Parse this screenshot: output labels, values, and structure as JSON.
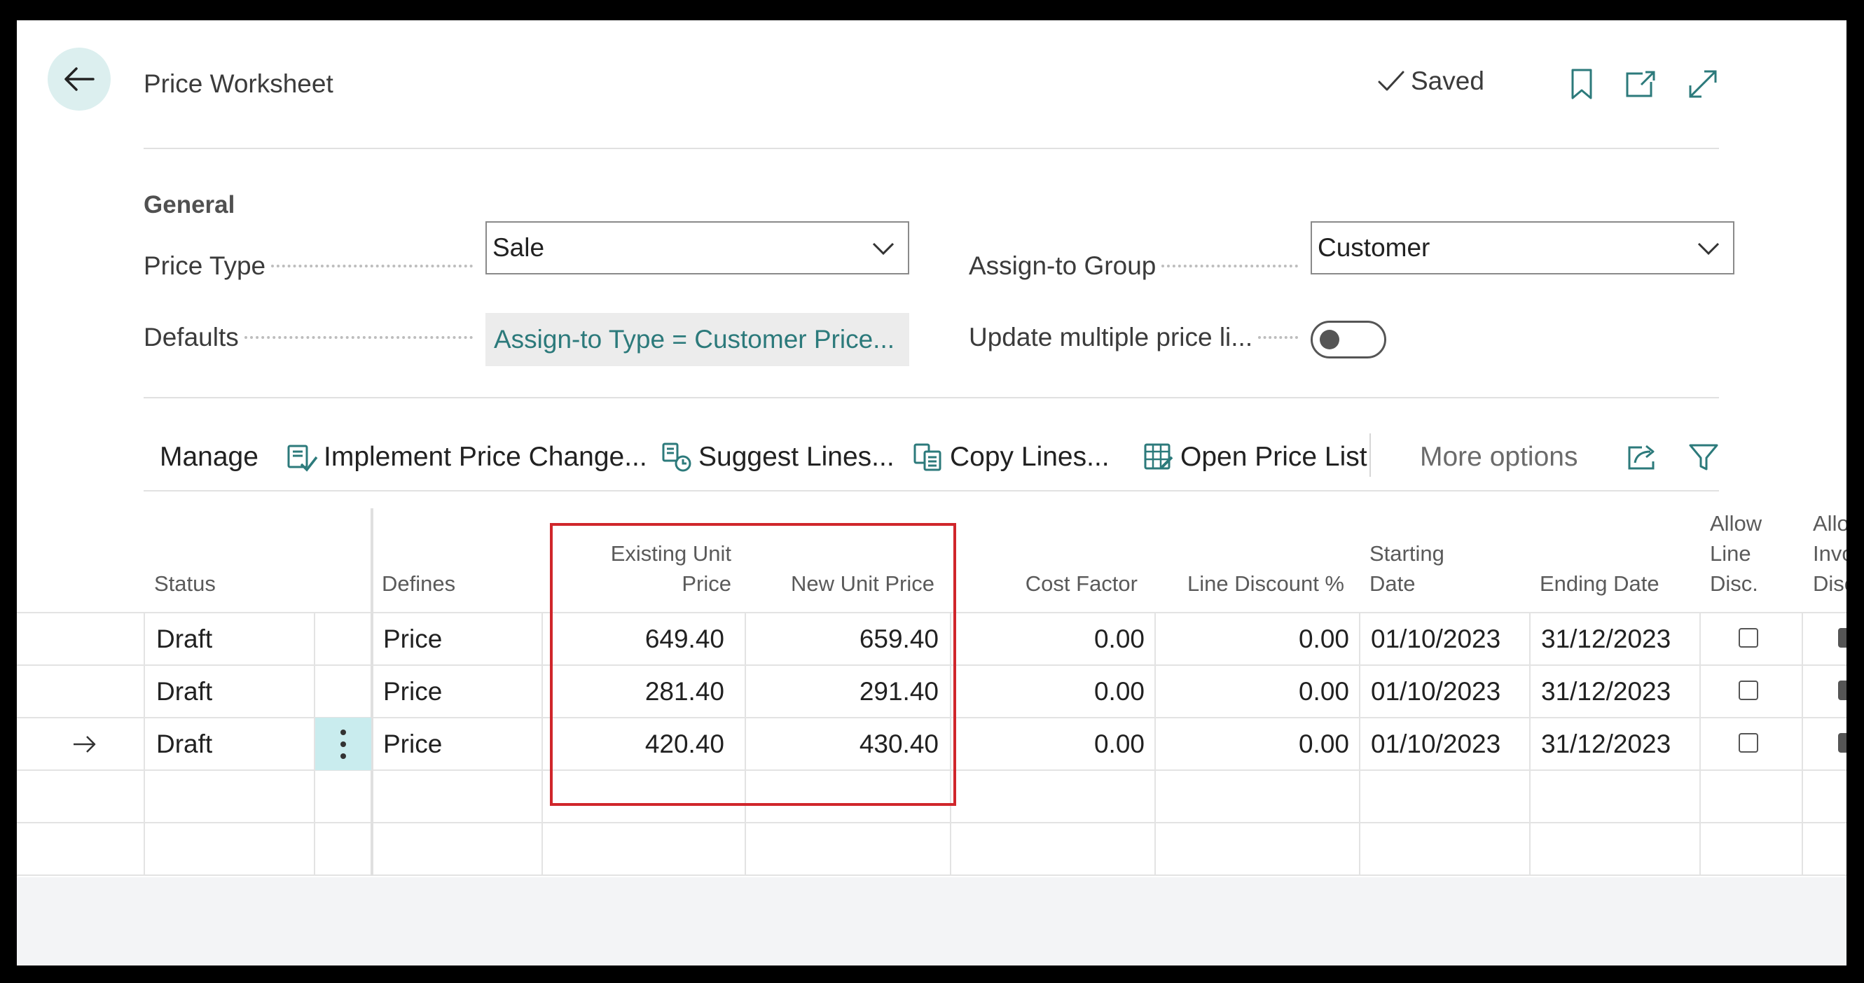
{
  "header": {
    "title": "Price Worksheet",
    "saved_label": "Saved"
  },
  "general": {
    "section_title": "General",
    "price_type_label": "Price Type",
    "price_type_value": "Sale",
    "defaults_label": "Defaults",
    "defaults_value": "Assign-to Type = Customer Price...",
    "assign_group_label": "Assign-to Group",
    "assign_group_value": "Customer",
    "update_multiple_label": "Update multiple price li...",
    "update_multiple_on": false
  },
  "actions": {
    "manage": "Manage",
    "implement": "Implement Price Change...",
    "suggest": "Suggest Lines...",
    "copy": "Copy Lines...",
    "open_price_list": "Open Price List",
    "more_options": "More options"
  },
  "table": {
    "columns": {
      "status": "Status",
      "defines": "Defines",
      "existing_unit_price_1": "Existing Unit",
      "existing_unit_price_2": "Price",
      "new_unit_price": "New Unit Price",
      "cost_factor": "Cost Factor",
      "line_discount": "Line Discount %",
      "starting_date_1": "Starting",
      "starting_date_2": "Date",
      "ending_date": "Ending Date",
      "allow_line_disc_1": "Allow",
      "allow_line_disc_2": "Line",
      "allow_line_disc_3": "Disc.",
      "allow_inv_disc_1": "Allo",
      "allow_inv_disc_2": "Invo",
      "allow_inv_disc_3": "Disc"
    },
    "rows": [
      {
        "status": "Draft",
        "defines": "Price",
        "existing": "649.40",
        "new": "659.40",
        "cost_factor": "0.00",
        "line_discount": "0.00",
        "start": "01/10/2023",
        "end": "31/12/2023",
        "allow_line_disc": false,
        "selected": false
      },
      {
        "status": "Draft",
        "defines": "Price",
        "existing": "281.40",
        "new": "291.40",
        "cost_factor": "0.00",
        "line_discount": "0.00",
        "start": "01/10/2023",
        "end": "31/12/2023",
        "allow_line_disc": false,
        "selected": false
      },
      {
        "status": "Draft",
        "defines": "Price",
        "existing": "420.40",
        "new": "430.40",
        "cost_factor": "0.00",
        "line_discount": "0.00",
        "start": "01/10/2023",
        "end": "31/12/2023",
        "allow_line_disc": false,
        "selected": true
      }
    ]
  },
  "colors": {
    "accent_teal": "#2c7a7b",
    "back_button_bg": "#dcefef",
    "selected_cell_bg": "#c9ecee",
    "highlight_red": "#d0262b"
  }
}
